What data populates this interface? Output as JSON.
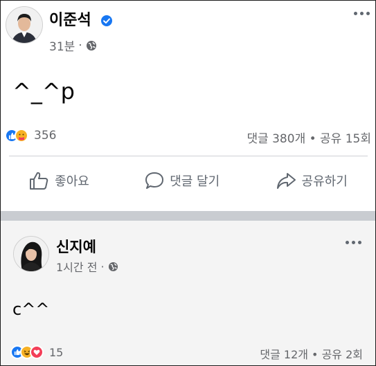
{
  "post1": {
    "author": "이준석",
    "time": "31분",
    "separator": "·",
    "content": "^_^p",
    "reactions_count": "356",
    "comments_shares": "댓글 380개 • 공유 15회",
    "actions": {
      "like": "좋아요",
      "comment": "댓글 달기",
      "share": "공유하기"
    }
  },
  "post2": {
    "author": "신지예",
    "time": "1시간 전",
    "separator": "·",
    "content": "c^^",
    "reactions_count": "15",
    "comments_shares": "댓글 12개 • 공유 2회"
  },
  "colors": {
    "like_blue": "#1877f2",
    "love_red": "#f33e58",
    "haha_yellow": "#f7b125",
    "separator_gray": "#c9ccd1"
  }
}
